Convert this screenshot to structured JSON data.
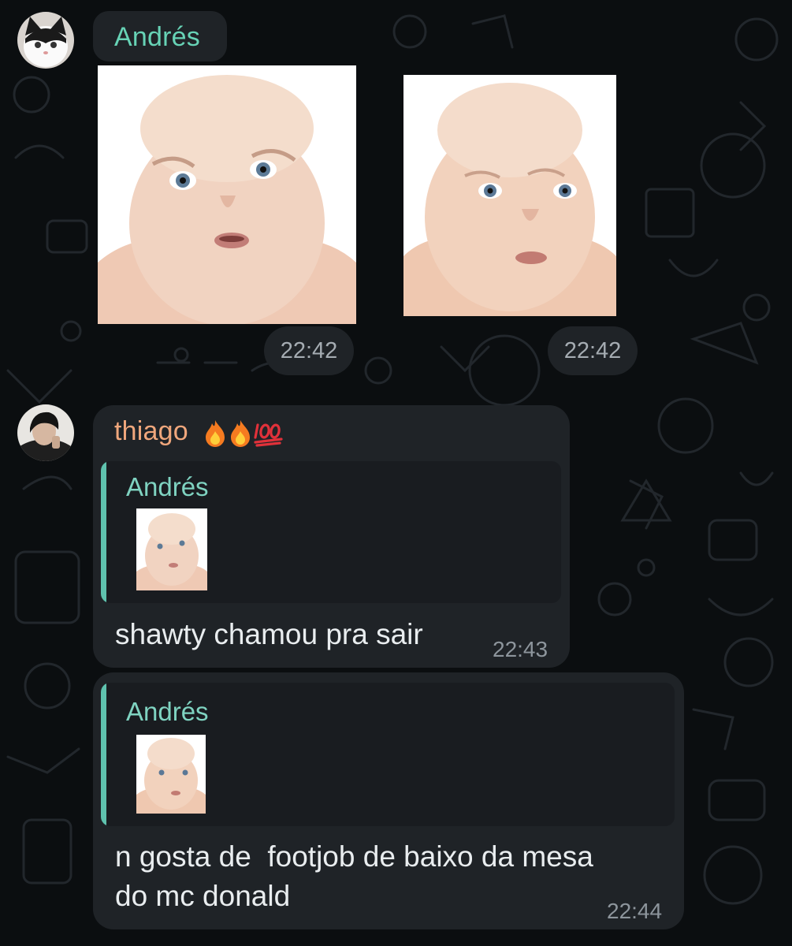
{
  "messages": [
    {
      "sender": "Andrés",
      "sender_color": "#67d3b6",
      "images": [
        {
          "description": "baby-face",
          "time": "22:42"
        },
        {
          "description": "baby-face",
          "time": "22:42"
        }
      ]
    },
    {
      "sender": "thiago",
      "sender_color": "#f0a77c",
      "sender_emojis": [
        "fire-emoji",
        "fire-emoji",
        "hundred-points-emoji"
      ],
      "reply_to": {
        "sender": "Andrés"
      },
      "text": "shawty chamou pra sair",
      "time": "22:43"
    },
    {
      "reply_to": {
        "sender": "Andrés"
      },
      "text": "n gosta de  footjob de baixo da mesa\ndo mc donald",
      "time": "22:44"
    }
  ],
  "colors": {
    "background": "#0b0e10",
    "bubble": "#1f2327",
    "quote_accent": "#5fc2ae",
    "text": "#e9edef",
    "timestamp": "#8d959c"
  }
}
